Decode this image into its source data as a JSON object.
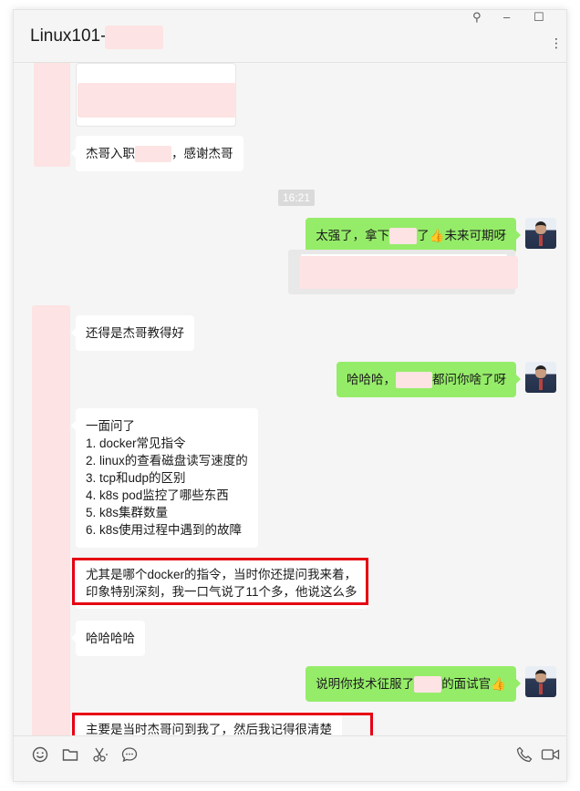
{
  "window": {
    "title": "Linux101-"
  },
  "controls": {
    "pin_icon": "pin-icon",
    "minimize_icon": "minimize-icon",
    "maximize_icon": "maximize-icon",
    "more_icon": "more-dots-icon",
    "pin_glyph": "⚲",
    "min_glyph": "–",
    "max_glyph": "☐",
    "more_glyph": "⋮"
  },
  "chat": {
    "timestamp": "16:21",
    "messages": [
      {
        "id": "m1",
        "side": "in",
        "text_before": "杰哥入职",
        "text_after": "，感谢杰哥"
      },
      {
        "id": "m2",
        "side": "out",
        "text_before": "太强了，拿下",
        "text_after": "了👍未来可期呀"
      },
      {
        "id": "m3",
        "side": "in",
        "text": "还得是杰哥教得好"
      },
      {
        "id": "m4",
        "side": "out",
        "text_before": "哈哈哈，",
        "text_after": "都问你啥了呀"
      },
      {
        "id": "m5",
        "side": "in",
        "lines": [
          "一面问了",
          "1. docker常见指令",
          "2. linux的查看磁盘读写速度的",
          "3. tcp和udp的区别",
          "4. k8s pod监控了哪些东西",
          "5. k8s集群数量",
          "6. k8s使用过程中遇到的故障"
        ]
      },
      {
        "id": "m6",
        "side": "in",
        "lines": [
          "尤其是哪个docker的指令，当时你还提问我来着，",
          "印象特别深刻，我一口气说了11个多，他说这么多"
        ]
      },
      {
        "id": "m7",
        "side": "in",
        "text": "哈哈哈哈"
      },
      {
        "id": "m8",
        "side": "out",
        "text_before": "说明你技术征服了",
        "text_after": "的面试官👍"
      },
      {
        "id": "m9",
        "side": "in",
        "text": "主要是当时杰哥问到我了，然后我记得很清楚"
      }
    ]
  },
  "toolbar": {
    "icons": [
      "emoji-icon",
      "folder-icon",
      "scissors-icon",
      "chat-bubble-icon",
      "phone-icon",
      "video-call-icon"
    ]
  },
  "colors": {
    "outgoing_bubble": "#95ec69",
    "incoming_bubble": "#ffffff",
    "highlight_border": "#e60012",
    "redaction": "#fde3e3"
  }
}
